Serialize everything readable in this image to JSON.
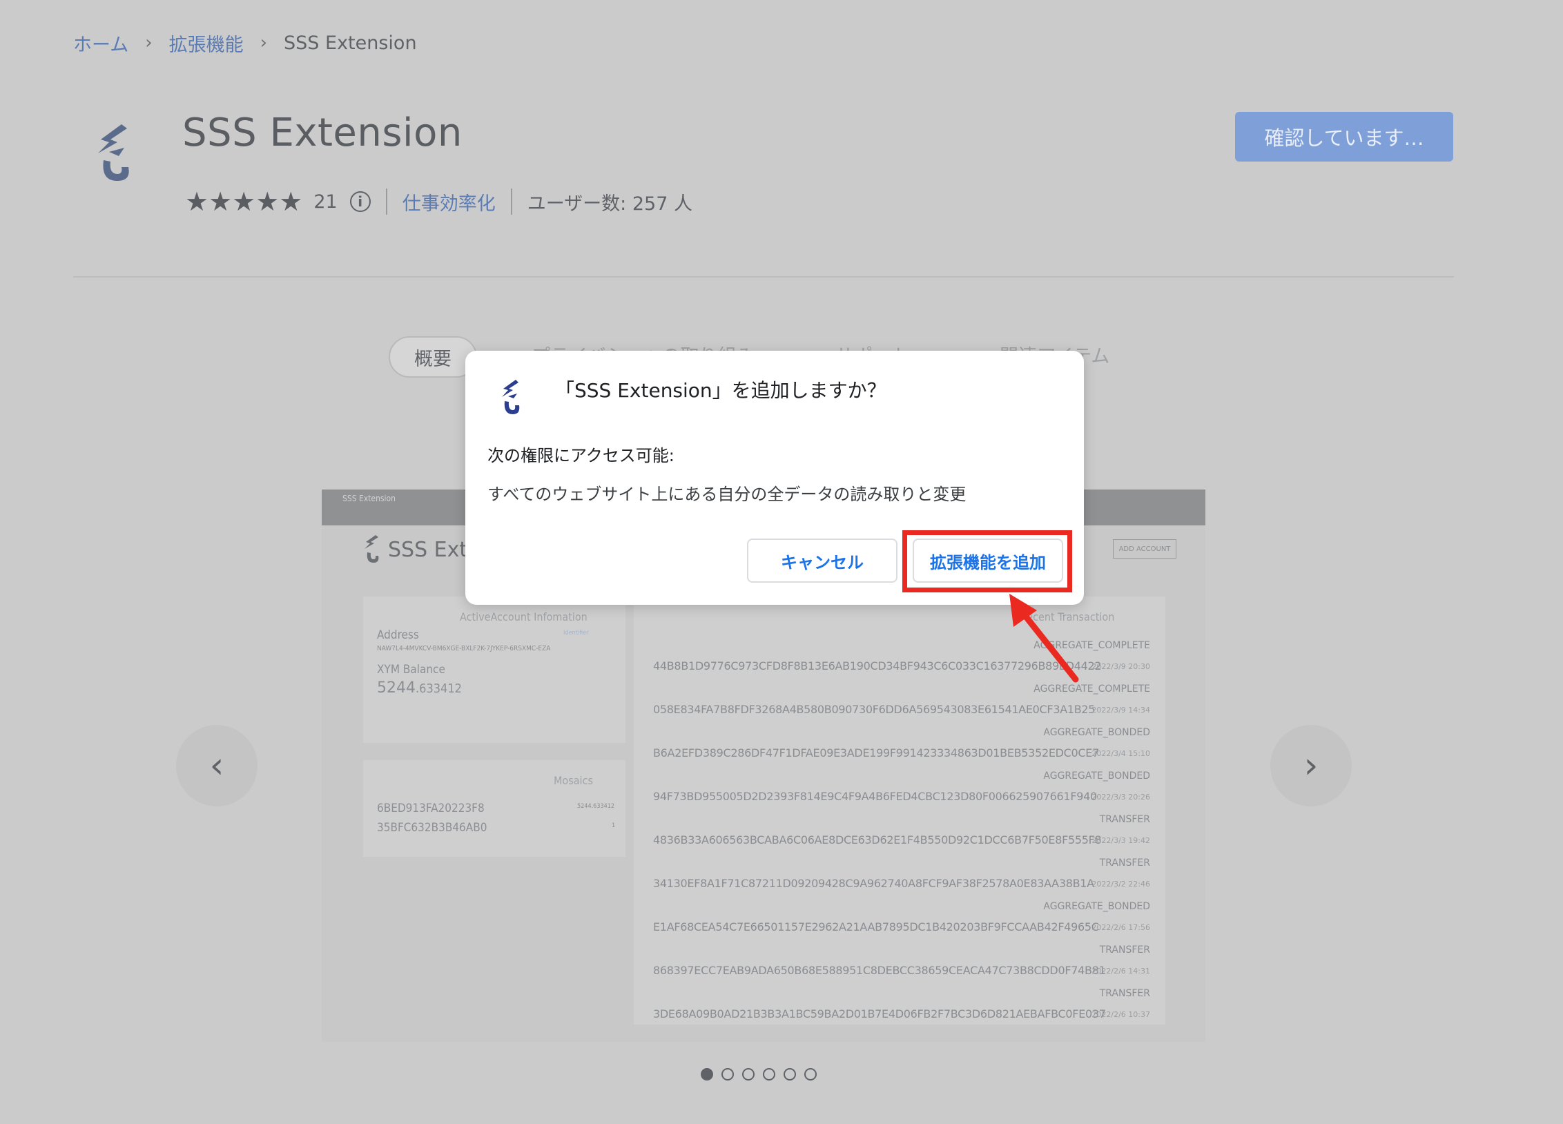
{
  "breadcrumb": {
    "home": "ホーム",
    "extensions": "拡張機能",
    "current": "SSS Extension"
  },
  "header": {
    "title": "SSS Extension",
    "stars": "★★★★★",
    "rating_count": "21",
    "info_glyph": "i",
    "category": "仕事効率化",
    "users": "ユーザー数: 257 人",
    "checking_button": "確認しています…"
  },
  "tabs": {
    "overview": "概要",
    "privacy": "プライバシーへの取り組み",
    "support": "サポート",
    "related": "関連アイテム"
  },
  "screenshot": {
    "window_tab": "SSS Extension",
    "logo_text": "SSS Exten",
    "add_account": "ADD ACCOUNT",
    "active_account_title": "ActiveAccount Infomation",
    "address_label": "Address",
    "address_badge": "Identifier",
    "address_value": "NAW7L4-4MVKCV-BM6XGE-BXLF2K-7JYKEP-6RSXMC-EZA",
    "balance_label": "XYM Balance",
    "balance_int": "5244",
    "balance_dec": ".633412",
    "mosaics_title": "Mosaics",
    "mosaics": [
      {
        "id": "6BED913FA20223F8",
        "amount": "5244.633412"
      },
      {
        "id": "35BFC632B3B46AB0",
        "amount": "1"
      }
    ],
    "recent_title": "Recent Transaction",
    "transactions": [
      {
        "type": "AGGREGATE_COMPLETE",
        "hash": "44B8B1D9776C973CFD8F8B13E6AB190CD34BF943C6C033C16377296B89ED4422",
        "date": "2022/3/9 20:30"
      },
      {
        "type": "AGGREGATE_COMPLETE",
        "hash": "058E834FA7B8FDF3268A4B580B090730F6DD6A569543083E61541AE0CF3A1B25",
        "date": "2022/3/9 14:34"
      },
      {
        "type": "AGGREGATE_BONDED",
        "hash": "B6A2EFD389C286DF47F1DFAE09E3ADE199F991423334863D01BEB5352EDC0CE7",
        "date": "2022/3/4 15:10"
      },
      {
        "type": "AGGREGATE_BONDED",
        "hash": "94F73BD955005D2D2393F814E9C4F9A4B6FED4CBC123D80F006625907661F940",
        "date": "2022/3/3 20:26"
      },
      {
        "type": "TRANSFER",
        "hash": "4836B33A606563BCABA6C06AE8DCE63D62E1F4B550D92C1DCC6B7F50E8F555F8",
        "date": "2022/3/3 19:42"
      },
      {
        "type": "TRANSFER",
        "hash": "34130EF8A1F71C87211D09209428C9A962740A8FCF9AF38F2578A0E83AA38B1A",
        "date": "2022/3/2 22:46"
      },
      {
        "type": "AGGREGATE_BONDED",
        "hash": "E1AF68CEA54C7E66501157E2962A21AAB7895DC1B420203BF9FCCAAB42F4965C",
        "date": "2022/2/6 17:56"
      },
      {
        "type": "TRANSFER",
        "hash": "868397ECC7EAB9ADA650B68E588951C8DEBCC38659CEACA47C73B8CDD0F74B81",
        "date": "2022/2/6 14:31"
      },
      {
        "type": "TRANSFER",
        "hash": "3DE68A09B0AD21B3B3A1BC59BA2D01B7E4D06FB2F7BC3D6D821AEBAFBC0FE037",
        "date": "2022/2/6 10:37"
      }
    ]
  },
  "carousel": {
    "left_glyph": "‹",
    "right_glyph": "›",
    "dot_count": 6,
    "active_dot": 1
  },
  "dialog": {
    "title": "「SSS Extension」を追加しますか？",
    "permissions_heading": "次の権限にアクセス可能:",
    "permission_item": "すべてのウェブサイト上にある自分の全データの読み取りと変更",
    "cancel_label": "キャンセル",
    "add_label": "拡張機能を追加"
  },
  "colors": {
    "accent": "#1a73e8",
    "highlight": "#ea2a21",
    "overlay": "#cbcbcb",
    "link_dimmed": "#5b7bb4",
    "checking_button_bg": "#7f9fd8"
  }
}
